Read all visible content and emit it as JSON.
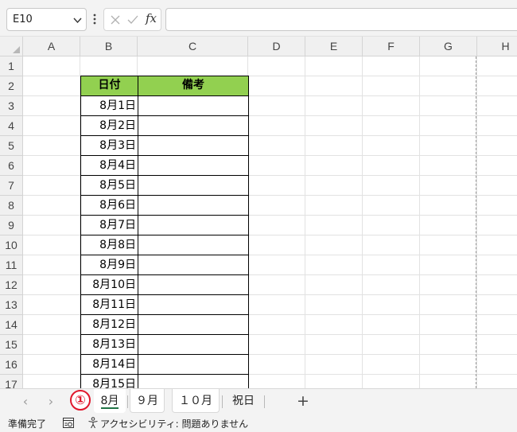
{
  "formula_bar": {
    "name_box": "E10",
    "formula_value": ""
  },
  "columns": [
    "A",
    "B",
    "C",
    "D",
    "E",
    "F",
    "G",
    "H"
  ],
  "rows": [
    "1",
    "2",
    "3",
    "4",
    "5",
    "6",
    "7",
    "8",
    "9",
    "10",
    "11",
    "12",
    "13",
    "14",
    "15",
    "16",
    "17"
  ],
  "table": {
    "header": [
      "日付",
      "備考"
    ],
    "dates": [
      "8月1日",
      "8月2日",
      "8月3日",
      "8月4日",
      "8月5日",
      "8月6日",
      "8月7日",
      "8月8日",
      "8月9日",
      "8月10日",
      "8月11日",
      "8月12日",
      "8月13日",
      "8月14日",
      "8月15日"
    ],
    "header_color": "#92d050"
  },
  "sheet_tabs": {
    "tabs": [
      "8月",
      "９月",
      "１０月",
      "祝日"
    ],
    "active": "8月",
    "marker": "①",
    "marker_color": "#e0162b",
    "add_label": "+",
    "prev_label": "‹",
    "next_label": "›"
  },
  "status_bar": {
    "ready": "準備完了",
    "accessibility": "アクセシビリティ: 問題ありません"
  }
}
